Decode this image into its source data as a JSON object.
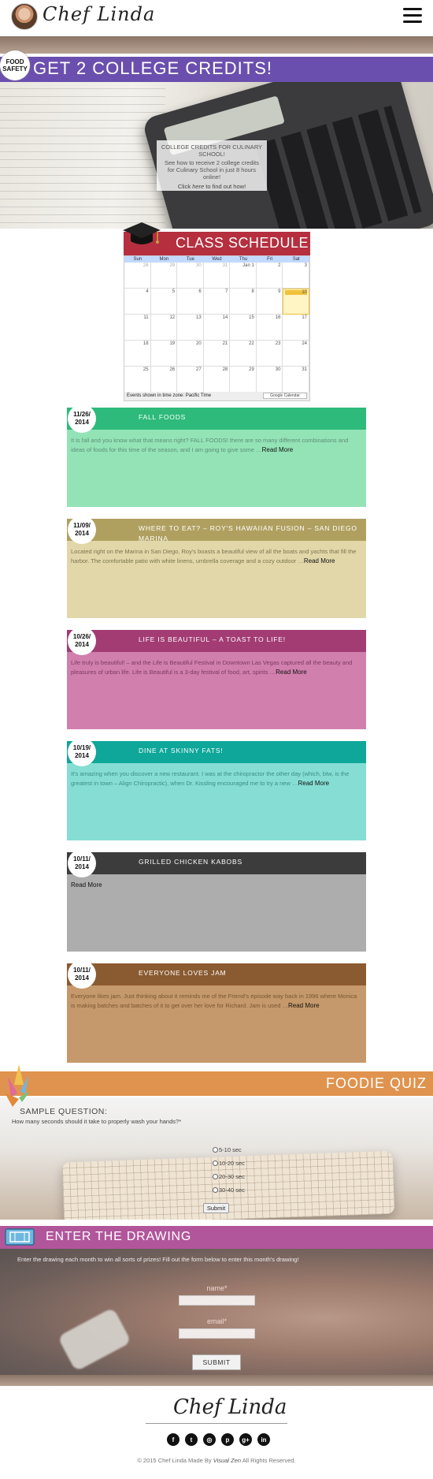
{
  "header": {
    "logo_text": "Chef Linda",
    "menu_icon": "hamburger-menu-icon"
  },
  "hero": {
    "badge_line1": "FOOD",
    "badge_line2": "SAFETY",
    "title": "GET 2 COLLEGE CREDITS!",
    "box_title": "COLLEGE CREDITS FOR CULINARY SCHOOL!",
    "box_text": "See how to receive 2 college credits for Culinary School in just 8 hours online!",
    "box_link_prefix": "Click ",
    "box_link_word": "here",
    "box_link_suffix": " to find out how!"
  },
  "schedule": {
    "title": "CLASS SCHEDULE",
    "days": [
      "Sun",
      "Mon",
      "Tue",
      "Wed",
      "Thu",
      "Fri",
      "Sat"
    ],
    "weeks": [
      [
        {
          "d": "28",
          "m": true
        },
        {
          "d": "29",
          "m": true
        },
        {
          "d": "30",
          "m": true
        },
        {
          "d": "31",
          "m": true
        },
        {
          "d": "Jan 1",
          "m": false
        },
        {
          "d": "2",
          "m": false
        },
        {
          "d": "3",
          "m": false
        }
      ],
      [
        {
          "d": "4",
          "m": false
        },
        {
          "d": "5",
          "m": false
        },
        {
          "d": "6",
          "m": false
        },
        {
          "d": "7",
          "m": false
        },
        {
          "d": "8",
          "m": false
        },
        {
          "d": "9",
          "m": false
        },
        {
          "d": "10",
          "m": false,
          "today": true
        }
      ],
      [
        {
          "d": "11",
          "m": false
        },
        {
          "d": "12",
          "m": false
        },
        {
          "d": "13",
          "m": false
        },
        {
          "d": "14",
          "m": false
        },
        {
          "d": "15",
          "m": false
        },
        {
          "d": "16",
          "m": false
        },
        {
          "d": "17",
          "m": false
        }
      ],
      [
        {
          "d": "18",
          "m": false
        },
        {
          "d": "19",
          "m": false
        },
        {
          "d": "20",
          "m": false
        },
        {
          "d": "21",
          "m": false
        },
        {
          "d": "22",
          "m": false
        },
        {
          "d": "23",
          "m": false
        },
        {
          "d": "24",
          "m": false
        }
      ],
      [
        {
          "d": "25",
          "m": false
        },
        {
          "d": "26",
          "m": false
        },
        {
          "d": "27",
          "m": false
        },
        {
          "d": "28",
          "m": false
        },
        {
          "d": "29",
          "m": false
        },
        {
          "d": "30",
          "m": false
        },
        {
          "d": "31",
          "m": false
        }
      ]
    ],
    "footer_text": "Events shown in time zone: Pacific Time",
    "gcal_label": "Google Calendar"
  },
  "posts": [
    {
      "date1": "11/26/",
      "date2": "2014",
      "title": "FALL FOODS",
      "excerpt": "It is fall and you know what that means right? FALL FOODS! there are so many different combinations and ideas of foods for this time of the season, and I am going to give some …",
      "more": "Read More",
      "bar_color": "#2dba7a",
      "body_color": "#93e3b6",
      "text_color": "#5f8f78"
    },
    {
      "date1": "11/09/",
      "date2": "2014",
      "title": "WHERE TO EAT? – ROY'S HAWAIIAN FUSION – SAN DIEGO MARINA",
      "excerpt": "Located right on the Marina in San Diego, Roy's boasts a beautiful view of all the boats and yachts that fill the harbor. The comfortable patio with white linens, umbrella coverage and a cozy outdoor …",
      "more": "Read More",
      "bar_color": "#b0a060",
      "body_color": "#e1d7a9",
      "text_color": "#7d7550"
    },
    {
      "date1": "10/26/",
      "date2": "2014",
      "title": "LIFE IS BEAUTIFUL – A TOAST TO LIFE!",
      "excerpt": "Life truly is beautiful! – and the Life is Beautiful Festival in Downtown Las Vegas captured all the beauty and pleasures of urban life. Life is Beautiful is a 3-day festival of food, art, spirits …",
      "more": "Read More",
      "bar_color": "#a23c73",
      "body_color": "#d17fad",
      "text_color": "#7d3a62"
    },
    {
      "date1": "10/19/",
      "date2": "2014",
      "title": "DINE AT SKINNY FATS!",
      "excerpt": "It's amazing when you discover a new restaurant. I was at the chiropractor the other day (which, btw, is the greatest in town – Align Chiropractic), when Dr. Kissling encouraged me to try a new …",
      "more": "Read More",
      "bar_color": "#0ea79a",
      "body_color": "#85ddd3",
      "text_color": "#3f8c84"
    },
    {
      "date1": "10/11/",
      "date2": "2014",
      "title": "GRILLED CHICKEN KABOBS",
      "excerpt": "",
      "more": "Read More",
      "bar_color": "#3c3c3c",
      "body_color": "#adadad",
      "text_color": "#555555"
    },
    {
      "date1": "10/11/",
      "date2": "2014",
      "title": "EVERYONE LOVES JAM",
      "excerpt": "Everyone likes jam. Just thinking about it reminds me of the Friend's episode way back in 1996 where Monica is making batches and batches of it to get over her love for Richard. Jam is used …",
      "more": "Read More",
      "bar_color": "#8a5a30",
      "body_color": "#c5996b",
      "text_color": "#7a5532"
    }
  ],
  "quiz": {
    "title": "FOODIE QUIZ",
    "question_head": "SAMPLE QUESTION:",
    "question": "How many seconds should it take to properly wash your hands?*",
    "options": [
      "5-10 sec",
      "10-20 sec",
      "20-30 sec",
      "30-40 sec"
    ],
    "submit_label": "Submit"
  },
  "drawing": {
    "title": "ENTER THE DRAWING",
    "text": "Enter the drawing each month to win all sorts of prizes! Fill out the form below to enter this month's drawing!",
    "name_label": "name*",
    "email_label": "email*",
    "submit_label": "SUBMIT"
  },
  "footer": {
    "logo_text": "Chef Linda",
    "socials": [
      "facebook-icon",
      "twitter-icon",
      "instagram-icon",
      "pinterest-icon",
      "google-plus-icon",
      "linkedin-icon"
    ],
    "social_glyphs": [
      "f",
      "t",
      "◎",
      "p",
      "g+",
      "in"
    ],
    "copyright_prefix": "© 2015 Chef Linda Made By ",
    "copyright_brand": "Visual Zen",
    "copyright_suffix": " All Rights Reserved."
  }
}
